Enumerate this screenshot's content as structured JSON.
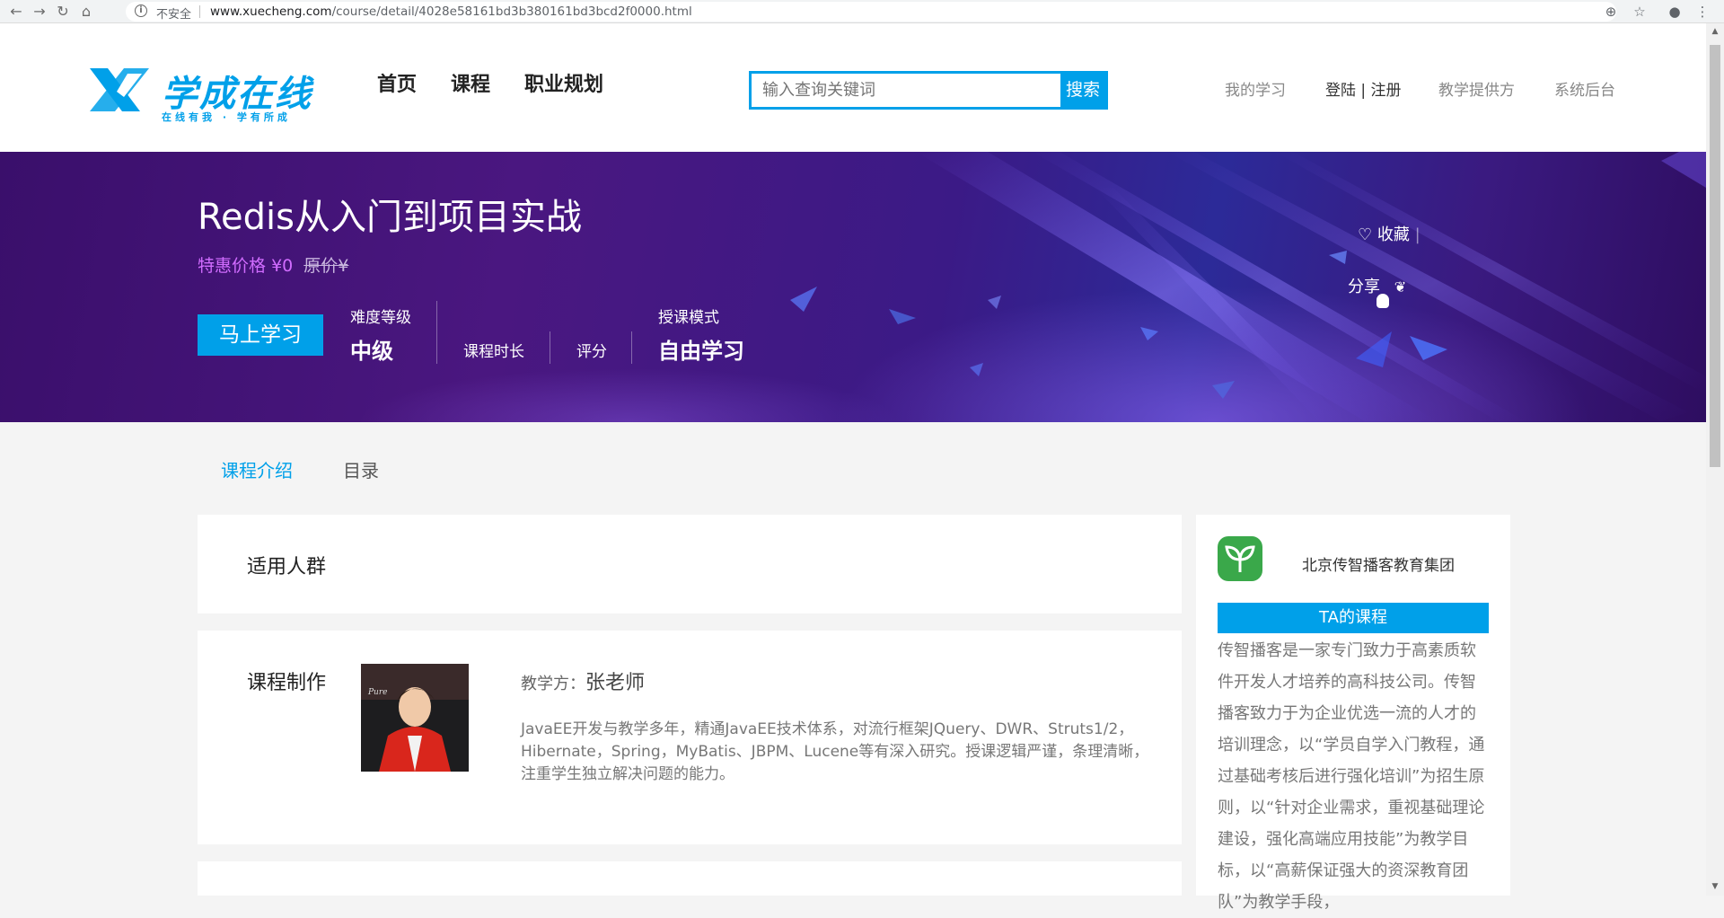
{
  "browser": {
    "insecure_label": "不安全",
    "url_host": "www.xuecheng.com",
    "url_path": "/course/detail/4028e58161bd3b380161bd3bcd2f0000.html"
  },
  "header": {
    "logo_text": "学成在线",
    "logo_sub": "在线有我 · 学有所成",
    "nav": [
      "首页",
      "课程",
      "职业规划"
    ],
    "search_placeholder": "输入查询关键词",
    "search_button": "搜索",
    "my_learning": "我的学习",
    "login": "登陆",
    "register_sep": " | ",
    "register": "注册",
    "teaching_provider": "教学提供方",
    "system_admin": "系统后台"
  },
  "course": {
    "title": "Redis从入门到项目实战",
    "special_price_label": "特惠价格",
    "special_price": "¥0",
    "original_price_label": "原价¥",
    "start_button": "马上学习",
    "difficulty_label": "难度等级",
    "difficulty_value": "中级",
    "duration_label": "课程时长",
    "rating_label": "评分",
    "mode_label": "授课模式",
    "mode_value": "自由学习",
    "favorite": "收藏",
    "share": "分享"
  },
  "tabs": [
    "课程介绍",
    "目录"
  ],
  "sections": {
    "audience_title": "适用人群",
    "production_title": "课程制作",
    "teacher_prefix": "教学方：",
    "teacher_name": "张老师",
    "teacher_desc": "JavaEE开发与教学多年，精通JavaEE技术体系，对流行框架JQuery、DWR、Struts1/2，Hibernate，Spring，MyBatis、JBPM、Lucene等有深入研究。授课逻辑严谨，条理清晰，注重学生独立解决问题的能力。"
  },
  "org": {
    "name": "北京传智播客教育集团",
    "ta_courses": "TA的课程",
    "description": "传智播客是一家专门致力于高素质软件开发人才培养的高科技公司。传智播客致力于为企业优选一流的人才的培训理念，以“学员自学入门教程，通过基础考核后进行强化培训”为招生原则，以“针对企业需求，重视基础理论建设，强化高端应用技能”为教学目标，以“高薪保证强大的资深教育团队”为教学手段，"
  },
  "colors": {
    "accent": "#00a0e9",
    "special_price": "#d16cff",
    "banner_base": "#3b1a86"
  }
}
